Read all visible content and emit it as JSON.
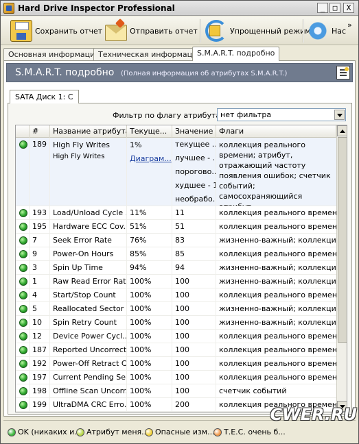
{
  "window": {
    "title": "Hard Drive Inspector Professional",
    "minimize": "_",
    "maximize": "□",
    "close": "X"
  },
  "toolbar": {
    "save": "Сохранить отчет",
    "send": "Отправить отчет",
    "simple": "Упрощенный режим",
    "settings": "Нас",
    "more": "»"
  },
  "tabs": [
    "Основная информация",
    "Техническая информация",
    "S.M.A.R.T. подробно"
  ],
  "header": {
    "title": "S.M.A.R.T. подробно",
    "subtitle": "(Полная информация об атрибутах S.M.A.R.T.)"
  },
  "disk_tab": "SATA Диск 1: C",
  "filter": {
    "label": "Фильтр по флагу атрибута:",
    "value": "нет фильтра"
  },
  "columns": [
    "#",
    "Название атрибута",
    "Текуще...",
    "Значение",
    "Флаги"
  ],
  "selected_row": {
    "id": "189",
    "name": "High Fly Writes",
    "name2": "High Fly Writes",
    "current": "1%",
    "diagram": "Диаграм...",
    "values": [
      "текущее ...",
      "лучшее - ...",
      "порогово...",
      "худшее - 1",
      "необрабо..."
    ],
    "flags": "коллекция реального времени; атрибут, отражающий частоту появления ошибок; счетчик событий; самосохраняющийся атрибут"
  },
  "rows": [
    {
      "id": "193",
      "name": "Load/Unload Cycle ...",
      "current": "11%",
      "value": "11",
      "flags": "коллекция реального времен..."
    },
    {
      "id": "195",
      "name": "Hardware ECC Cov...",
      "current": "51%",
      "value": "51",
      "flags": "коллекция реального времен..."
    },
    {
      "id": "7",
      "name": "Seek Error Rate",
      "current": "76%",
      "value": "83",
      "flags": "жизненно-важный; коллекция ..."
    },
    {
      "id": "9",
      "name": "Power-On Hours",
      "current": "85%",
      "value": "85",
      "flags": "коллекция реального времен..."
    },
    {
      "id": "3",
      "name": "Spin Up Time",
      "current": "94%",
      "value": "94",
      "flags": "жизненно-важный; коллекция ..."
    },
    {
      "id": "1",
      "name": "Raw Read Error Rate",
      "current": "100%",
      "value": "100",
      "flags": "жизненно-важный; коллекция ..."
    },
    {
      "id": "4",
      "name": "Start/Stop Count",
      "current": "100%",
      "value": "100",
      "flags": "коллекция реального времен..."
    },
    {
      "id": "5",
      "name": "Reallocated Sector ...",
      "current": "100%",
      "value": "100",
      "flags": "жизненно-важный; коллекция ..."
    },
    {
      "id": "10",
      "name": "Spin Retry Count",
      "current": "100%",
      "value": "100",
      "flags": "жизненно-важный; коллекция ..."
    },
    {
      "id": "12",
      "name": "Device Power Cycl...",
      "current": "100%",
      "value": "100",
      "flags": "коллекция реального времен..."
    },
    {
      "id": "187",
      "name": "Reported Uncorrect",
      "current": "100%",
      "value": "100",
      "flags": "коллекция реального времен..."
    },
    {
      "id": "192",
      "name": "Power-Off Retract C...",
      "current": "100%",
      "value": "100",
      "flags": "коллекция реального времен..."
    },
    {
      "id": "197",
      "name": "Current Pending Se...",
      "current": "100%",
      "value": "100",
      "flags": "коллекция реального времен..."
    },
    {
      "id": "198",
      "name": "Offline Scan Uncorr...",
      "current": "100%",
      "value": "100",
      "flags": "счетчик событий"
    },
    {
      "id": "199",
      "name": "UltraDMA CRC Erro...",
      "current": "100%",
      "value": "200",
      "flags": "коллекция реального времен..."
    }
  ],
  "legend": [
    {
      "label": "OK (никаких и...",
      "color": "#3cb83c"
    },
    {
      "label": "Атрибут меня...",
      "color": "#b8d84a"
    },
    {
      "label": "Опасные изм...",
      "color": "#f2d23a"
    },
    {
      "label": "Т.Е.С. очень б...",
      "color": "#f29a4a"
    }
  ],
  "watermark": "CWER.RU"
}
